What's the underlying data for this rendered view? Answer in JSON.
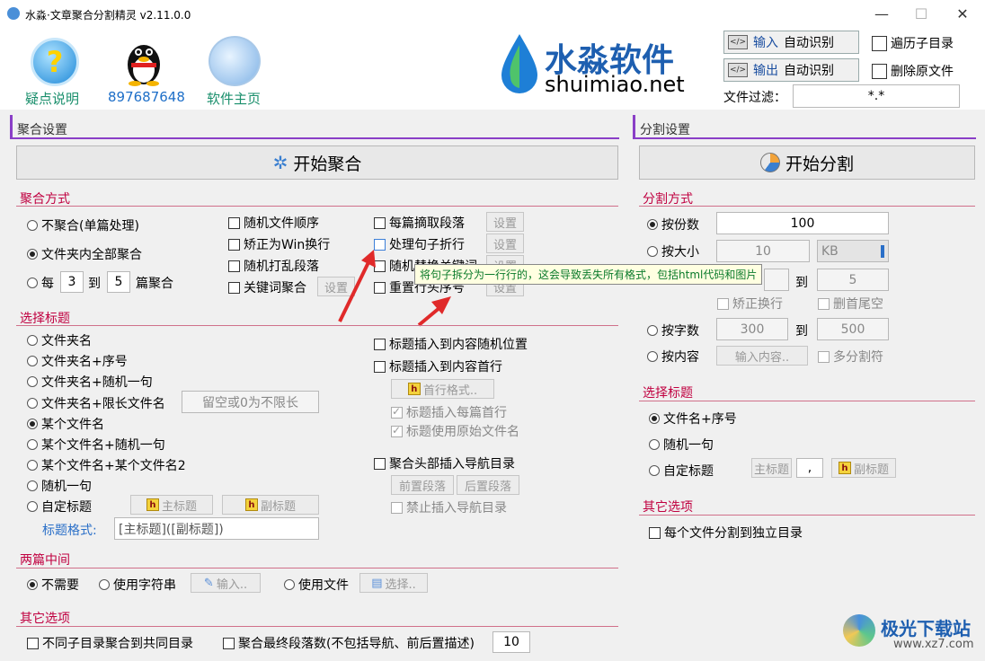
{
  "window": {
    "title": "水淼·文章聚合分割精灵 v2.11.0.0",
    "min": "—",
    "max": "☐",
    "close": "✕"
  },
  "header": {
    "help_label": "疑点说明",
    "qq_label": "897687648",
    "home_label": "软件主页",
    "brand_cn": "水淼软件",
    "brand_en": "shuimiao.net",
    "input_btn_a": "输入",
    "input_btn_b": "自动识别",
    "output_btn_a": "输出",
    "output_btn_b": "自动识别",
    "traverse_label": "遍历子目录",
    "delete_label": "删除原文件",
    "filter_label": "文件过滤：",
    "filter_value": "*.*"
  },
  "merge": {
    "section_title": "聚合设置",
    "start_label": "开始聚合",
    "mode_title": "聚合方式",
    "mode_options": [
      "不聚合(单篇处理)",
      "文件夹内全部聚合"
    ],
    "every_label": "每",
    "every_from": "3",
    "to_label": "到",
    "every_to": "5",
    "every_suffix": "篇聚合",
    "cb_col2": [
      "随机文件顺序",
      "矫正为Win换行",
      "随机打乱段落",
      "关键词聚合"
    ],
    "settings_label": "设置",
    "cb_col3": [
      "每篇摘取段落",
      "处理句子折行",
      "随机替换关键词",
      "重置行头序号"
    ],
    "tooltip": "将句子拆分为一行行的，这会导致丢失所有格式，包括html代码和图片",
    "title_group": "选择标题",
    "title_options": [
      "文件夹名",
      "文件夹名+序号",
      "文件夹名+随机一句",
      "文件夹名+限长文件名",
      "某个文件名",
      "某个文件名+随机一句",
      "某个文件名+某个文件名2",
      "随机一句",
      "自定标题"
    ],
    "limit_placeholder": "留空或0为不限长",
    "main_title_btn": "主标题",
    "sub_title_btn": "副标题",
    "format_label": "标题格式:",
    "format_value": "[主标题]([副标题])",
    "insert_random": "标题插入到内容随机位置",
    "insert_first": "标题插入到内容首行",
    "first_format_btn": "首行格式..",
    "insert_each_first": "标题插入每篇首行",
    "use_orig_name": "标题使用原始文件名",
    "nav_label": "聚合头部插入导航目录",
    "pre_para_btn": "前置段落",
    "post_para_btn": "后置段落",
    "no_nav_label": "禁止插入导航目录",
    "between_title": "两篇中间",
    "between_none": "不需要",
    "between_string": "使用字符串",
    "input_btn": "输入..",
    "between_file": "使用文件",
    "choose_btn": "选择..",
    "other_title": "其它选项",
    "other_diff_dir": "不同子目录聚合到共同目录",
    "other_final_count": "聚合最终段落数(不包括导航、前后置描述)",
    "final_count_value": "10"
  },
  "split": {
    "section_title": "分割设置",
    "start_label": "开始分割",
    "mode_title": "分割方式",
    "by_count": "按份数",
    "count_value": "100",
    "by_size": "按大小",
    "size_value": "10",
    "size_unit": "KB",
    "para_to": "到",
    "para_to_value": "5",
    "correct_break": "矫正换行",
    "delete_tail": "删首尾空",
    "by_chars": "按字数",
    "chars_from": "300",
    "chars_to_label": "到",
    "chars_to": "500",
    "by_content": "按内容",
    "content_btn": "输入内容..",
    "multi_sep": "多分割符",
    "title_group": "选择标题",
    "title_options": [
      "文件名+序号",
      "随机一句",
      "自定标题"
    ],
    "main_title_btn": "主标题",
    "sep_value": ",",
    "sub_title_btn": "副标题",
    "other_title": "其它选项",
    "other_each_dir": "每个文件分割到独立目录"
  },
  "watermark": {
    "cn": "极光下载站",
    "en": "www.xz7.com"
  }
}
